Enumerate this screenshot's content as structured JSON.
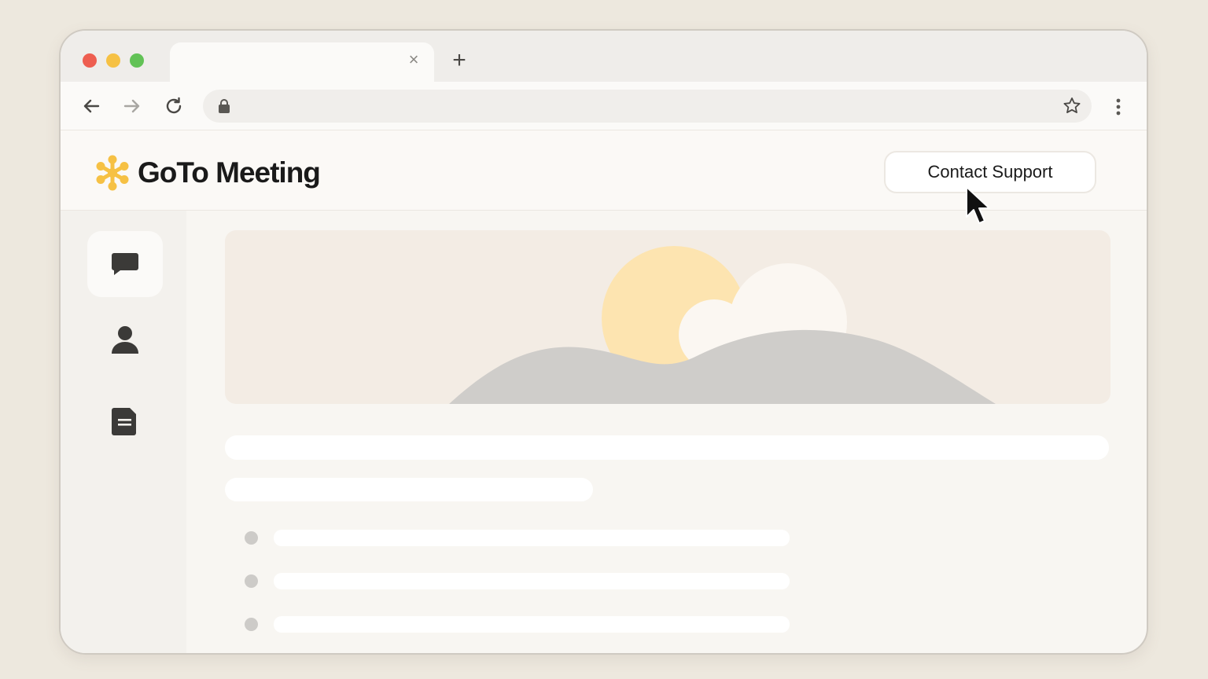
{
  "browser": {
    "tab_close_glyph": "×",
    "new_tab_glyph": "+",
    "icons": [
      "back-arrow-icon",
      "forward-arrow-icon",
      "reload-icon",
      "lock-icon",
      "star-icon",
      "kebab-menu-icon"
    ]
  },
  "header": {
    "logo_text": "GoTo Meeting",
    "contact_support_label": "Contact Support"
  },
  "sidebar": {
    "items": [
      {
        "icon": "chat-bubble-icon",
        "active": true
      },
      {
        "icon": "person-icon",
        "active": false
      },
      {
        "icon": "document-icon",
        "active": false
      }
    ]
  },
  "colors": {
    "accent_logo": "#f6c144",
    "window_bg": "#f8f6f2",
    "page_bg": "#ede8de"
  }
}
